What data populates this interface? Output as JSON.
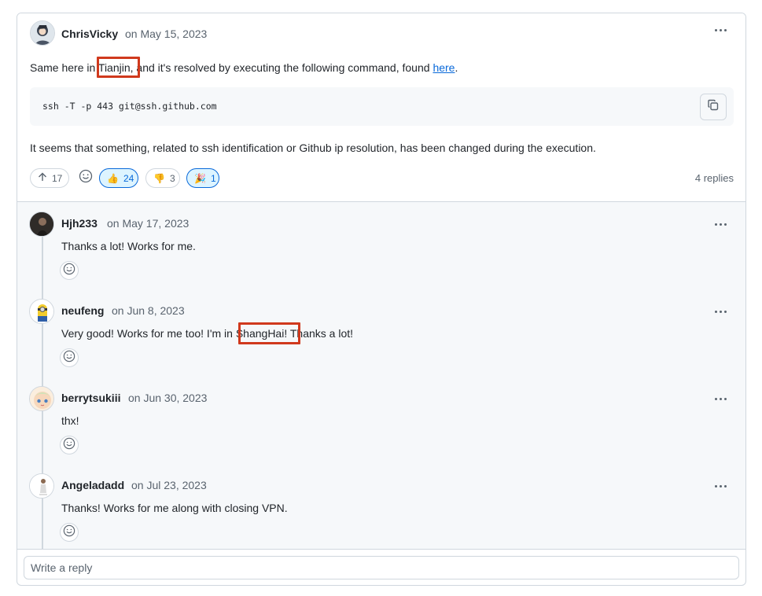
{
  "comment": {
    "author": "ChrisVicky",
    "date": "on May 15, 2023",
    "text_before": "Same here in ",
    "text_city": "Tianjin,",
    "text_after": " and it's resolved by executing the following command, found ",
    "link_text": "here",
    "text_end": ".",
    "code": "ssh -T -p 443 git@ssh.github.com",
    "followup": "It seems that something, related to ssh identification or Github ip resolution, has been changed during the execution.",
    "upvotes": "17",
    "reactions": [
      {
        "emoji": "👍",
        "count": "24",
        "active": true
      },
      {
        "emoji": "👎",
        "count": "3",
        "active": false
      },
      {
        "emoji": "🎉",
        "count": "1",
        "active": true
      }
    ],
    "reply_count": "4 replies"
  },
  "replies": [
    {
      "author": "Hjh233",
      "date": "on May 17, 2023",
      "text": "Thanks a lot!  Works for me."
    },
    {
      "author": "neufeng",
      "date": "on Jun 8, 2023",
      "text_before": "Very good! Works for me too! I'm in ",
      "text_city": "ShangHai!",
      "text_after": " Thanks a lot!"
    },
    {
      "author": "berrytsukiii",
      "date": "on Jun 30, 2023",
      "text": "thx!"
    },
    {
      "author": "Angeladadd",
      "date": "on Jul 23, 2023",
      "text": "Thanks! Works for me along with closing VPN."
    }
  ],
  "reply_input": {
    "placeholder": "Write a reply"
  },
  "colors": {
    "highlight": "#d0391d",
    "link": "#0969da",
    "border": "#d0d7de"
  }
}
